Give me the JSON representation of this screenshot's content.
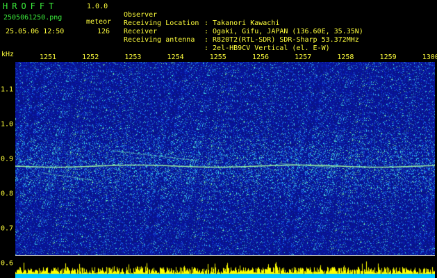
{
  "app": {
    "title": "HROFFT",
    "version": "1.0.0",
    "filename": "2505061250.png",
    "mode": "meteor",
    "datetime": "25.05.06 12:50",
    "count": "126"
  },
  "metadata": [
    {
      "label": "Observer",
      "value": ": Takanori Kawachi"
    },
    {
      "label": "Receiving Location",
      "value": ": Ogaki, Gifu, JAPAN (136.60E, 35.35N)"
    },
    {
      "label": "Receiver",
      "value": ": R820T2(RTL-SDR) SDR-Sharp 53.372MHz"
    },
    {
      "label": "Receiving antenna",
      "value": ": 2el-HB9CV Vertical (el. E-W)"
    }
  ],
  "axis": {
    "freq_unit": "kHz",
    "time_ticks": [
      "1251",
      "1252",
      "1253",
      "1254",
      "1255",
      "1256",
      "1257",
      "1258",
      "1259",
      "1300"
    ],
    "freq_ticks": [
      "1.1",
      "1.0",
      "0.9",
      "0.8",
      "0.7",
      "0.6"
    ]
  },
  "colors": {
    "background": "#000000",
    "waterfall_base": "#0a1a8c",
    "label_green": "#3cf03c",
    "label_yellow": "#ffff3c",
    "power_bar": "#ffff00",
    "power_base": "#00c8ff"
  },
  "chart_data": {
    "type": "heatmap",
    "x_ticks": [
      "1251",
      "1252",
      "1253",
      "1254",
      "1255",
      "1256",
      "1257",
      "1258",
      "1259",
      "1300"
    ],
    "y_ticks": [
      1.1,
      1.0,
      0.9,
      0.8,
      0.7,
      0.6
    ],
    "y_unit": "kHz",
    "carrier_freq_khz": 0.88
  }
}
